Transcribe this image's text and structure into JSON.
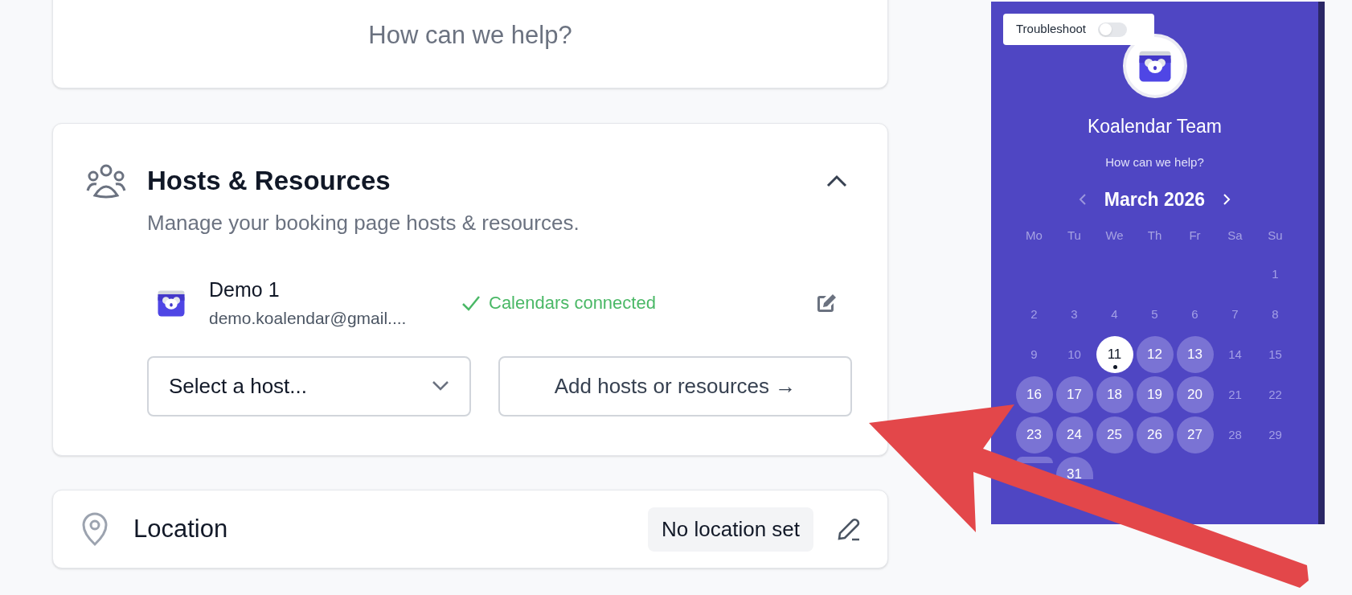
{
  "help_card": {
    "text": "How can we help?"
  },
  "hosts_card": {
    "title": "Hosts & Resources",
    "description": "Manage your booking page hosts & resources.",
    "expanded": true,
    "hosts": [
      {
        "name": "Demo 1",
        "email": "demo.koalendar@gmail....",
        "status": "Calendars connected"
      }
    ],
    "select": {
      "placeholder": "Select a host..."
    },
    "add_button": "Add hosts or resources →"
  },
  "location_card": {
    "title": "Location",
    "badge": "No location set"
  },
  "preview": {
    "troubleshoot": {
      "label": "Troubleshoot",
      "on": false
    },
    "team_name": "Koalendar Team",
    "subtitle": "How can we help?",
    "month": "March 2026",
    "weekdays": [
      "Mo",
      "Tu",
      "We",
      "Th",
      "Fr",
      "Sa",
      "Su"
    ],
    "days": [
      {
        "kind": "empty"
      },
      {
        "kind": "empty"
      },
      {
        "kind": "empty"
      },
      {
        "kind": "empty"
      },
      {
        "kind": "empty"
      },
      {
        "kind": "empty"
      },
      {
        "kind": "day",
        "label": "1",
        "available": false,
        "selected": false
      },
      {
        "kind": "day",
        "label": "2",
        "available": false,
        "selected": false
      },
      {
        "kind": "day",
        "label": "3",
        "available": false,
        "selected": false
      },
      {
        "kind": "day",
        "label": "4",
        "available": false,
        "selected": false
      },
      {
        "kind": "day",
        "label": "5",
        "available": false,
        "selected": false
      },
      {
        "kind": "day",
        "label": "6",
        "available": false,
        "selected": false
      },
      {
        "kind": "day",
        "label": "7",
        "available": false,
        "selected": false
      },
      {
        "kind": "day",
        "label": "8",
        "available": false,
        "selected": false
      },
      {
        "kind": "day",
        "label": "9",
        "available": false,
        "selected": false
      },
      {
        "kind": "day",
        "label": "10",
        "available": false,
        "selected": false
      },
      {
        "kind": "day",
        "label": "11",
        "available": true,
        "selected": true
      },
      {
        "kind": "day",
        "label": "12",
        "available": true,
        "selected": false
      },
      {
        "kind": "day",
        "label": "13",
        "available": true,
        "selected": false
      },
      {
        "kind": "day",
        "label": "14",
        "available": false,
        "selected": false
      },
      {
        "kind": "day",
        "label": "15",
        "available": false,
        "selected": false
      },
      {
        "kind": "day",
        "label": "16",
        "available": true,
        "selected": false
      },
      {
        "kind": "day",
        "label": "17",
        "available": true,
        "selected": false
      },
      {
        "kind": "day",
        "label": "18",
        "available": true,
        "selected": false
      },
      {
        "kind": "day",
        "label": "19",
        "available": true,
        "selected": false
      },
      {
        "kind": "day",
        "label": "20",
        "available": true,
        "selected": false
      },
      {
        "kind": "day",
        "label": "21",
        "available": false,
        "selected": false
      },
      {
        "kind": "day",
        "label": "22",
        "available": false,
        "selected": false
      },
      {
        "kind": "day",
        "label": "23",
        "available": true,
        "selected": false
      },
      {
        "kind": "day",
        "label": "24",
        "available": true,
        "selected": false
      },
      {
        "kind": "day",
        "label": "25",
        "available": true,
        "selected": false
      },
      {
        "kind": "day",
        "label": "26",
        "available": true,
        "selected": false
      },
      {
        "kind": "day",
        "label": "27",
        "available": true,
        "selected": false
      },
      {
        "kind": "day",
        "label": "28",
        "available": false,
        "selected": false
      },
      {
        "kind": "day",
        "label": "29",
        "available": false,
        "selected": false
      },
      {
        "kind": "day",
        "available": true,
        "selected": false
      },
      {
        "kind": "day",
        "label": "31",
        "available": true,
        "selected": false
      }
    ]
  }
}
